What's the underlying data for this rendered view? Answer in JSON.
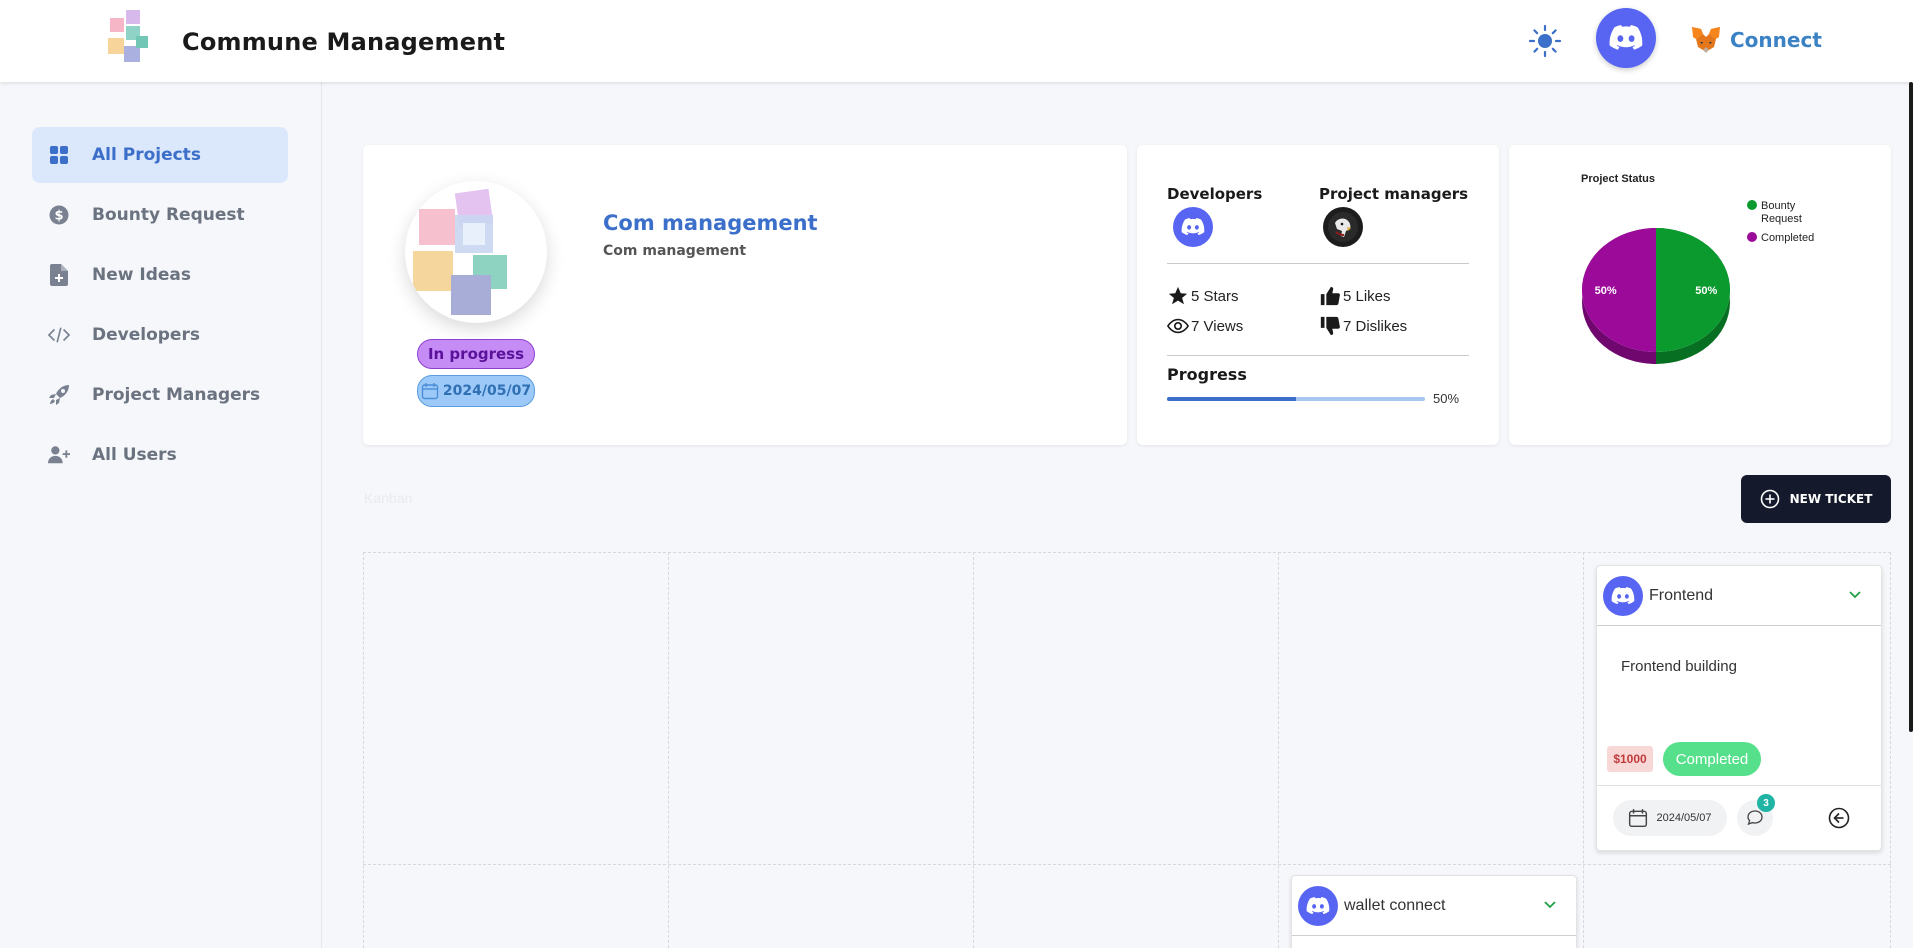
{
  "header": {
    "title": "Commune Management",
    "connect_label": "Connect"
  },
  "sidebar": {
    "items": [
      {
        "label": "All Projects",
        "icon": "grid-icon",
        "active": true
      },
      {
        "label": "Bounty Request",
        "icon": "dollar-icon",
        "active": false
      },
      {
        "label": "New Ideas",
        "icon": "file-plus-icon",
        "active": false
      },
      {
        "label": "Developers",
        "icon": "code-icon",
        "active": false
      },
      {
        "label": "Project Managers",
        "icon": "rocket-icon",
        "active": false
      },
      {
        "label": "All Users",
        "icon": "user-plus-icon",
        "active": false
      }
    ]
  },
  "project": {
    "name": "Com management",
    "description": "Com management",
    "status": "In progress",
    "date": "2024/05/07"
  },
  "stats": {
    "developers_label": "Developers",
    "managers_label": "Project managers",
    "stars": "5 Stars",
    "likes": "5 Likes",
    "views": "7 Views",
    "dislikes": "7 Dislikes",
    "progress_label": "Progress",
    "progress_value": 50,
    "progress_text": "50%"
  },
  "chart_data": {
    "type": "pie",
    "title": "Project Status",
    "categories": [
      "Bounty Request",
      "Completed"
    ],
    "values": [
      50,
      50
    ],
    "labels": [
      "50%",
      "50%"
    ],
    "colors": [
      "#0a9a2e",
      "#9b0a99"
    ],
    "legend": "top-right"
  },
  "board": {
    "kanban_label": "Kanban",
    "new_ticket_label": "NEW TICKET"
  },
  "tickets": [
    {
      "title": "Frontend",
      "description": "Frontend building",
      "bounty": "$1000",
      "status": "Completed",
      "date": "2024/05/07",
      "comments": "3"
    },
    {
      "title": "wallet connect"
    }
  ],
  "colors": {
    "accent": "#3b6fc9",
    "discord": "#5865f2",
    "dark_button": "#141a2b",
    "completed": "#57e08b"
  }
}
